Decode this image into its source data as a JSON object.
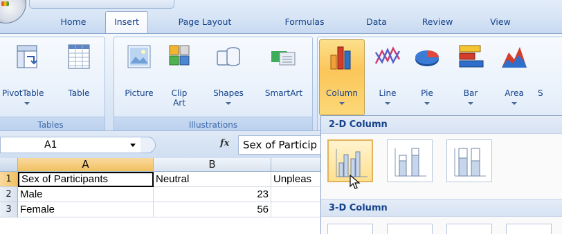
{
  "tabs": [
    {
      "label": "Home",
      "active": false
    },
    {
      "label": "Insert",
      "active": true
    },
    {
      "label": "Page Layout",
      "active": false
    },
    {
      "label": "Formulas",
      "active": false
    },
    {
      "label": "Data",
      "active": false
    },
    {
      "label": "Review",
      "active": false
    },
    {
      "label": "View",
      "active": false
    }
  ],
  "ribbon": {
    "tables": {
      "label": "Tables",
      "pivottable": "PivotTable",
      "table": "Table"
    },
    "illustrations": {
      "label": "Illustrations",
      "picture": "Picture",
      "clipart": "Clip\nArt",
      "shapes": "Shapes",
      "smartart": "SmartArt"
    },
    "charts": {
      "column": "Column",
      "line": "Line",
      "pie": "Pie",
      "bar": "Bar",
      "area": "Area",
      "scatter_partial": "S"
    }
  },
  "formula_bar": {
    "name_box": "A1",
    "fx_symbol": "fx",
    "formula": "Sex of Particip"
  },
  "sheet": {
    "columns": [
      "A",
      "B",
      ""
    ],
    "rows": [
      "1",
      "2",
      "3"
    ],
    "cells": [
      [
        "Sex of Participants",
        "Neutral",
        "Unpleas"
      ],
      [
        "Male",
        "23",
        ""
      ],
      [
        "Female",
        "56",
        ""
      ]
    ]
  },
  "gallery": {
    "section_2d": "2-D Column",
    "section_3d": "3-D Column"
  },
  "colors": {
    "accent": "#15428b",
    "ribbon_bg": "#dbe7f6",
    "pressed": "#fbc65a"
  }
}
